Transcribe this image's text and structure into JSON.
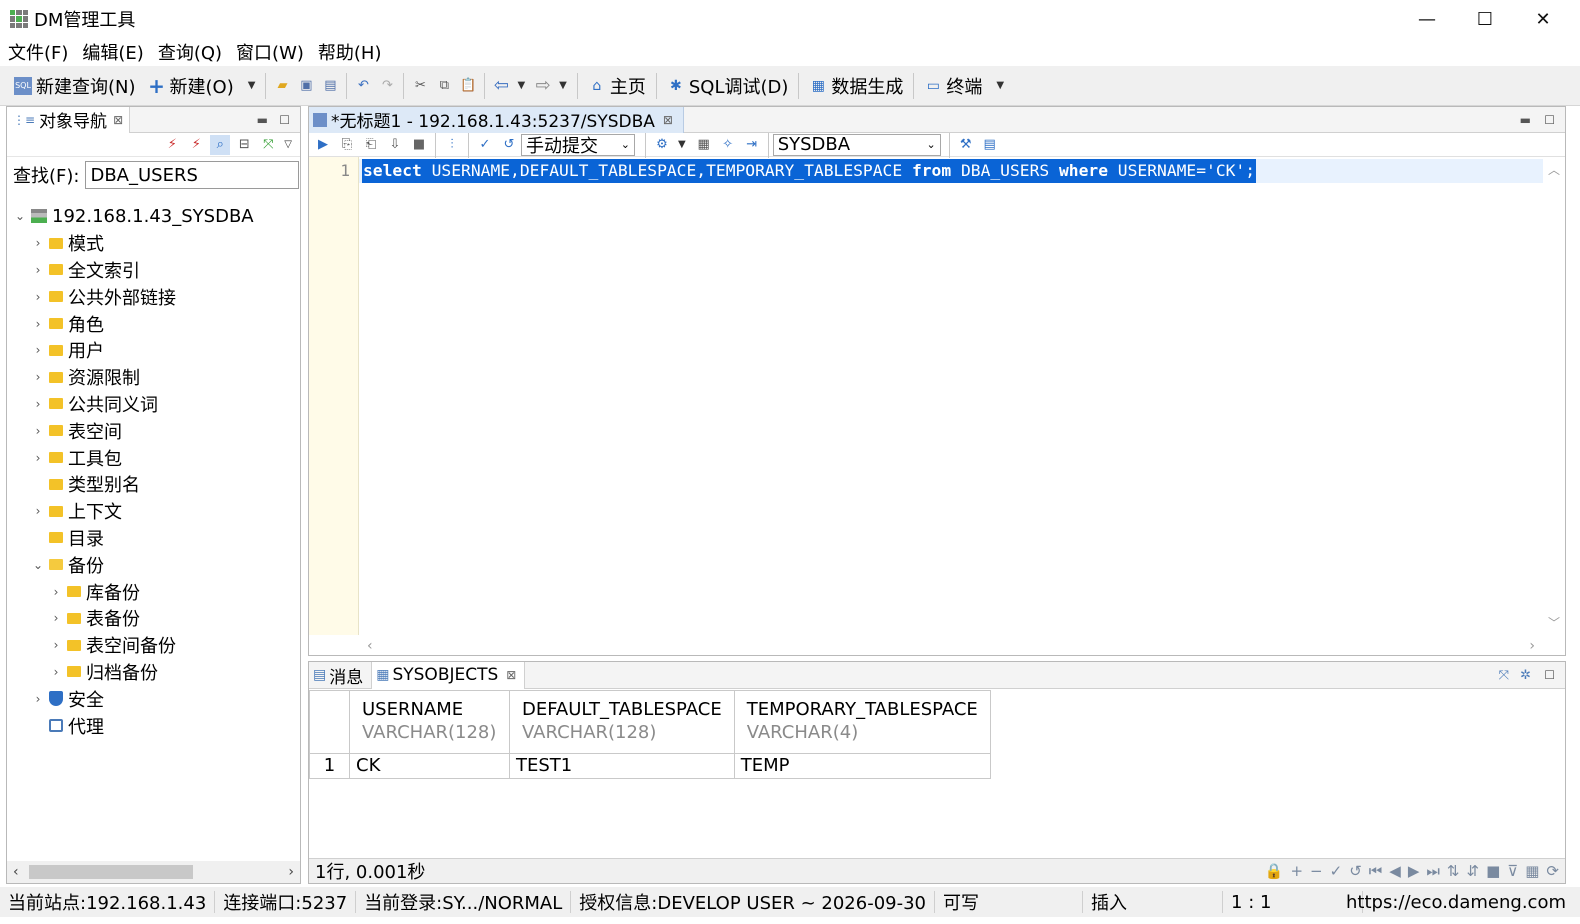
{
  "window": {
    "title": "DM管理工具"
  },
  "menu": [
    "文件(F)",
    "编辑(E)",
    "查询(Q)",
    "窗口(W)",
    "帮助(H)"
  ],
  "toolbar": {
    "new_query": "新建查询(N)",
    "new": "新建(O)",
    "home": "主页",
    "sql_debug": "SQL调试(D)",
    "data_gen": "数据生成",
    "terminal": "终端"
  },
  "nav": {
    "tab_label": "对象导航",
    "search_label": "查找(F):",
    "search_value": "DBA_USERS",
    "root": "192.168.1.43_SYSDBA",
    "items": [
      {
        "label": "模式",
        "twisty": "›",
        "indent": 1
      },
      {
        "label": "全文索引",
        "twisty": "›",
        "indent": 1
      },
      {
        "label": "公共外部链接",
        "twisty": "›",
        "indent": 1
      },
      {
        "label": "角色",
        "twisty": "›",
        "indent": 1
      },
      {
        "label": "用户",
        "twisty": "›",
        "indent": 1
      },
      {
        "label": "资源限制",
        "twisty": "›",
        "indent": 1
      },
      {
        "label": "公共同义词",
        "twisty": "›",
        "indent": 1
      },
      {
        "label": "表空间",
        "twisty": "›",
        "indent": 1
      },
      {
        "label": "工具包",
        "twisty": "›",
        "indent": 1
      },
      {
        "label": "类型别名",
        "twisty": "",
        "indent": 1
      },
      {
        "label": "上下文",
        "twisty": "›",
        "indent": 1
      },
      {
        "label": "目录",
        "twisty": "",
        "indent": 1
      },
      {
        "label": "备份",
        "twisty": "⌄",
        "indent": 1
      },
      {
        "label": "库备份",
        "twisty": "›",
        "indent": 2
      },
      {
        "label": "表备份",
        "twisty": "›",
        "indent": 2
      },
      {
        "label": "表空间备份",
        "twisty": "›",
        "indent": 2
      },
      {
        "label": "归档备份",
        "twisty": "›",
        "indent": 2
      },
      {
        "label": "安全",
        "twisty": "›",
        "indent": 1
      },
      {
        "label": "代理",
        "twisty": "",
        "indent": 1
      }
    ]
  },
  "editor": {
    "tab_label": "*无标题1 - 192.168.1.43:5237/SYSDBA",
    "commit_mode": "手动提交",
    "schema": "SYSDBA",
    "line_number": "1",
    "sql": {
      "kw_select": "select",
      "part1": " USERNAME,DEFAULT_TABLESPACE,TEMPORARY_TABLESPACE ",
      "kw_from": "from",
      "part2": " DBA_USERS ",
      "kw_where": "where",
      "part3": " USERNAME='CK';"
    }
  },
  "results": {
    "tab_messages": "消息",
    "tab_result": "SYSOBJECTS",
    "columns": [
      {
        "name": "USERNAME",
        "type": "VARCHAR(128)"
      },
      {
        "name": "DEFAULT_TABLESPACE",
        "type": "VARCHAR(128)"
      },
      {
        "name": "TEMPORARY_TABLESPACE",
        "type": "VARCHAR(4)"
      }
    ],
    "rows": [
      {
        "num": "1",
        "cells": [
          "CK",
          "TEST1",
          "TEMP"
        ]
      }
    ],
    "status": "1行, 0.001秒"
  },
  "statusbar": {
    "site": "当前站点:192.168.1.43",
    "port": "连接端口:5237",
    "login": "当前登录:SY.../NORMAL",
    "license": "授权信息:DEVELOP USER ~ 2026-09-30",
    "mode": "可写",
    "insert": "插入",
    "position": "1 : 1",
    "url": "https://eco.dameng.com"
  }
}
